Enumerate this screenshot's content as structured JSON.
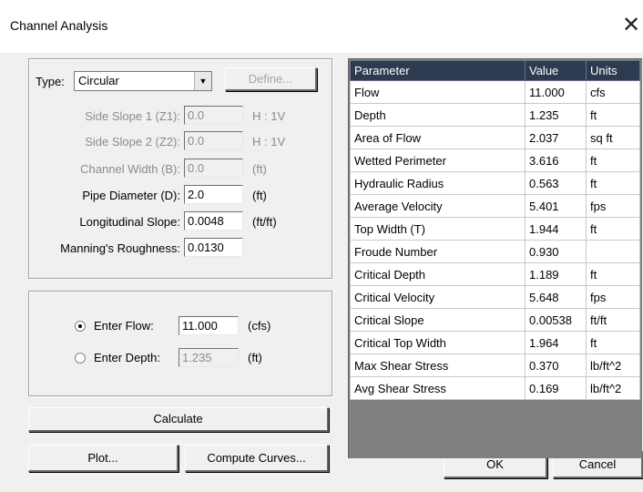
{
  "window": {
    "title": "Channel Analysis",
    "close_glyph": "✕"
  },
  "type": {
    "label": "Type:",
    "selected": "Circular",
    "define_label": "Define..."
  },
  "fields": {
    "side_slope_1": {
      "label": "Side Slope 1 (Z1):",
      "value": "0.0",
      "unit": "H : 1V"
    },
    "side_slope_2": {
      "label": "Side Slope 2 (Z2):",
      "value": "0.0",
      "unit": "H : 1V"
    },
    "channel_width": {
      "label": "Channel Width (B):",
      "value": "0.0",
      "unit": "(ft)"
    },
    "pipe_diameter": {
      "label": "Pipe Diameter (D):",
      "value": "2.0",
      "unit": "(ft)"
    },
    "long_slope": {
      "label": "Longitudinal Slope:",
      "value": "0.0048",
      "unit": "(ft/ft)"
    },
    "manning": {
      "label": "Manning's Roughness:",
      "value": "0.0130"
    }
  },
  "mode": {
    "flow": {
      "label": "Enter Flow:",
      "value": "11.000",
      "unit": "(cfs)",
      "checked": true
    },
    "depth": {
      "label": "Enter Depth:",
      "value": "1.235",
      "unit": "(ft)",
      "checked": false
    }
  },
  "buttons": {
    "calculate": "Calculate",
    "plot": "Plot...",
    "compute_curves": "Compute Curves...",
    "ok": "OK",
    "cancel": "Cancel"
  },
  "results": {
    "headers": [
      "Parameter",
      "Value",
      "Units"
    ],
    "rows": [
      [
        "Flow",
        "11.000",
        "cfs"
      ],
      [
        "Depth",
        "1.235",
        "ft"
      ],
      [
        "Area of Flow",
        "2.037",
        "sq ft"
      ],
      [
        "Wetted Perimeter",
        "3.616",
        "ft"
      ],
      [
        "Hydraulic Radius",
        "0.563",
        "ft"
      ],
      [
        "Average Velocity",
        "5.401",
        "fps"
      ],
      [
        "Top Width (T)",
        "1.944",
        "ft"
      ],
      [
        "Froude Number",
        "0.930",
        ""
      ],
      [
        "Critical Depth",
        "1.189",
        "ft"
      ],
      [
        "Critical Velocity",
        "5.648",
        "fps"
      ],
      [
        "Critical Slope",
        "0.00538",
        "ft/ft"
      ],
      [
        "Critical Top Width",
        "1.964",
        "ft"
      ],
      [
        "Max Shear Stress",
        "0.370",
        "lb/ft^2"
      ],
      [
        "Avg Shear Stress",
        "0.169",
        "lb/ft^2"
      ]
    ]
  }
}
